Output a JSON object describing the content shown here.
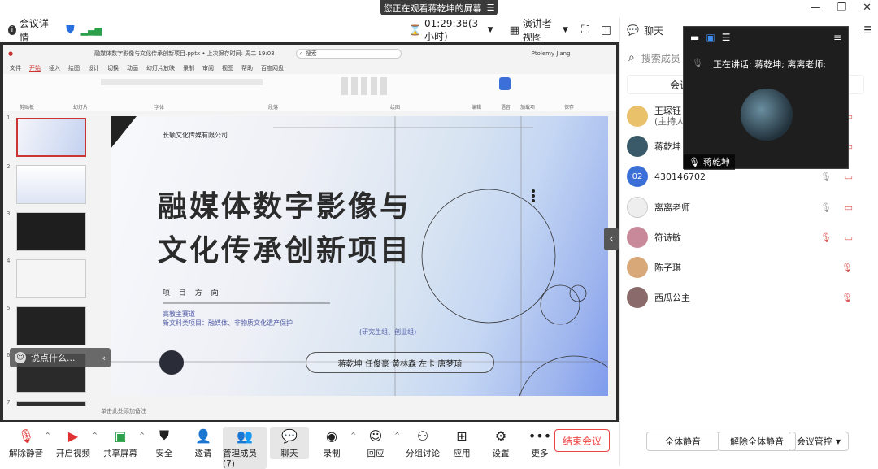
{
  "banner": {
    "text": "您正在观看蒋乾坤的屏幕",
    "icon": "menu-icon"
  },
  "window": {
    "minimize": "—",
    "restore": "❐",
    "close": "✕"
  },
  "topbar": {
    "info": "会议详情",
    "timer": "01:29:38(3小时)",
    "view": "演讲者视图"
  },
  "ppt": {
    "title": "融媒体数字影像与文化传承创新项目.pptx • 上次保存时间: 周二 19:03",
    "search": "搜索",
    "user": "Ptolemy Jiang",
    "menu": [
      "文件",
      "开始",
      "插入",
      "绘图",
      "设计",
      "切换",
      "动画",
      "幻灯片放映",
      "录制",
      "审阅",
      "视图",
      "帮助",
      "百度网盘"
    ],
    "ribbon_groups": [
      "剪贴板",
      "幻灯片",
      "字体",
      "段落",
      "绘图",
      "编辑",
      "语音",
      "加载项",
      "保存"
    ],
    "note": "单击此处添加备注",
    "thumb_numbers": [
      "1",
      "2",
      "3",
      "4",
      "5",
      "6",
      "7"
    ]
  },
  "slide": {
    "company": "长颖文化传媒有限公司",
    "title_line1": "融媒体数字影像与",
    "title_line2": "文化传承创新项目",
    "direction": "项 目 方 向",
    "line1": "高教主赛道",
    "line2": "新文科类项目：融媒体、非物质文化遗产保护",
    "group": "(研究生组、创业组)",
    "names": "蒋乾坤  任俊豪  黄林森  左卡  唐梦琦"
  },
  "chat_input": {
    "placeholder": "说点什么..."
  },
  "bottom": [
    {
      "label": "解除静音",
      "icon": "mic-muted-icon"
    },
    {
      "label": "开启视频",
      "icon": "camera-off-icon"
    },
    {
      "label": "共享屏幕",
      "icon": "share-screen-icon"
    },
    {
      "label": "安全",
      "icon": "shield-icon"
    },
    {
      "label": "邀请",
      "icon": "invite-icon"
    },
    {
      "label": "管理成员(7)",
      "icon": "members-icon"
    },
    {
      "label": "聊天",
      "icon": "chat-icon"
    },
    {
      "label": "录制",
      "icon": "record-icon"
    },
    {
      "label": "回应",
      "icon": "reaction-icon"
    },
    {
      "label": "分组讨论",
      "icon": "breakout-icon"
    },
    {
      "label": "应用",
      "icon": "apps-icon"
    },
    {
      "label": "设置",
      "icon": "settings-icon"
    },
    {
      "label": "更多",
      "icon": "more-icon"
    }
  ],
  "end_meeting": "结束会议",
  "right_panel": {
    "title": "聊天",
    "search_placeholder": "搜索成员",
    "tab": "会议",
    "members": [
      {
        "name": "王琛钰",
        "sub": "(主持人",
        "avatar_color": "#e8c16a"
      },
      {
        "name": "蒋乾坤",
        "sub": "",
        "avatar_color": "#3a5a6a"
      },
      {
        "name": "430146702",
        "sub": "",
        "avatar_color": "#3d6fd9",
        "avatar_text": "02"
      },
      {
        "name": "离离老师",
        "sub": "",
        "avatar_color": "#eeeeee"
      },
      {
        "name": "符诗敏",
        "sub": "",
        "avatar_color": "#c88a9a"
      },
      {
        "name": "陈子琪",
        "sub": "",
        "avatar_color": "#d9a878"
      },
      {
        "name": "西瓜公主",
        "sub": "",
        "avatar_color": "#8a6a6a"
      }
    ],
    "mute_all": "全体静音",
    "unmute_all": "解除全体静音",
    "manage": "会议管控"
  },
  "speaker": {
    "speaking": "正在讲话:  蒋乾坤; 离离老师;",
    "name": "蒋乾坤"
  }
}
